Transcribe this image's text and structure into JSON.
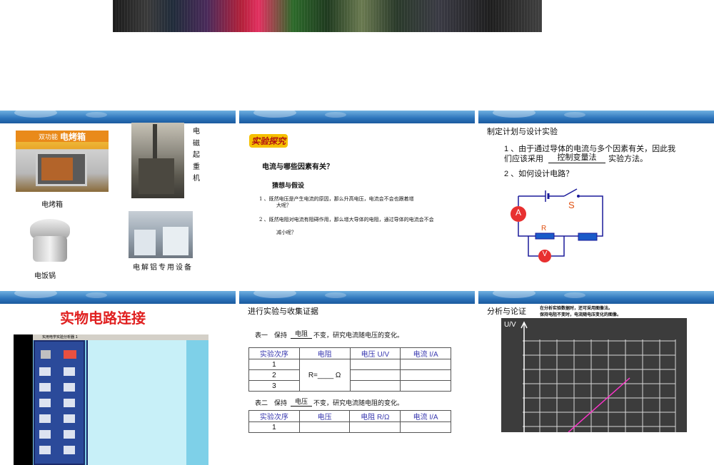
{
  "colors": {
    "header_blue": "#2d74bb",
    "title_red": "#e02020",
    "accent_blue": "#3a3ab0",
    "graph_bg": "#3c3c3c",
    "graph_line": "#ff33cc"
  },
  "slide1": {
    "oven_brand": "双功能",
    "oven_name": "电烤箱",
    "oven_label": "电烤箱",
    "crane_label": "电磁起重机",
    "rice_label": "电饭锅",
    "equipment_label": "电解铝专用设备"
  },
  "slide2": {
    "logo_text": "实验探究",
    "question": "电流与哪些因素有关？",
    "hypothesis_title": "猜想与假设",
    "hyp1_line1": "1 、既然电压是产生电流的原因，那么升高电压，电流会不会也跟着增",
    "hyp1_line2": "大呢？",
    "hyp2_line1": "2 、既然电阻对电流有阻碍作用，那么增大导体的电阻，通过导体的电流会不会",
    "hyp2_line2": "减小呢？"
  },
  "slide3": {
    "title": "制定计划与设计实验",
    "p1_line1": "1 、由于通过导体的电流与多个因素有关，因此我",
    "p1_line2_prefix": "们应该采用",
    "p1_method": "控制变量法",
    "p1_line2_suffix": "实验方法。",
    "p2": "2 、如何设计电路？",
    "ammeter": "A",
    "voltmeter": "V",
    "switch_label": "S",
    "resistor_label": "R"
  },
  "slide4": {
    "title": "实物电路连接",
    "sim_title": "实用电学实验分析器 1"
  },
  "slide5": {
    "title": "进行实验与收集证据",
    "table1_caption_prefix": "表一　保持",
    "table1_keep": "电阻",
    "table1_caption_suffix": "不变，研究电流随电压的变化。",
    "table1_headers": [
      "实验次序",
      "电阻",
      "电压 U/V",
      "电流 I/A"
    ],
    "table1_rows": [
      "1",
      "2",
      "3"
    ],
    "table1_r_value": "R=____ Ω",
    "table2_caption_prefix": "表二　保持",
    "table2_keep": "电压",
    "table2_caption_suffix": "不变，研究电流随电阻的变化。",
    "table2_headers": [
      "实验次序",
      "电压",
      "电阻 R/Ω",
      "电流 I/A"
    ],
    "table2_rows": [
      "1"
    ]
  },
  "slide6": {
    "title": "分析与论证",
    "note_line1": "在分析实验数据时，还可采用图像法。",
    "note_line2": "保持电阻不变时，电流随电压变化的图像。",
    "y_axis_label": "U/V"
  }
}
